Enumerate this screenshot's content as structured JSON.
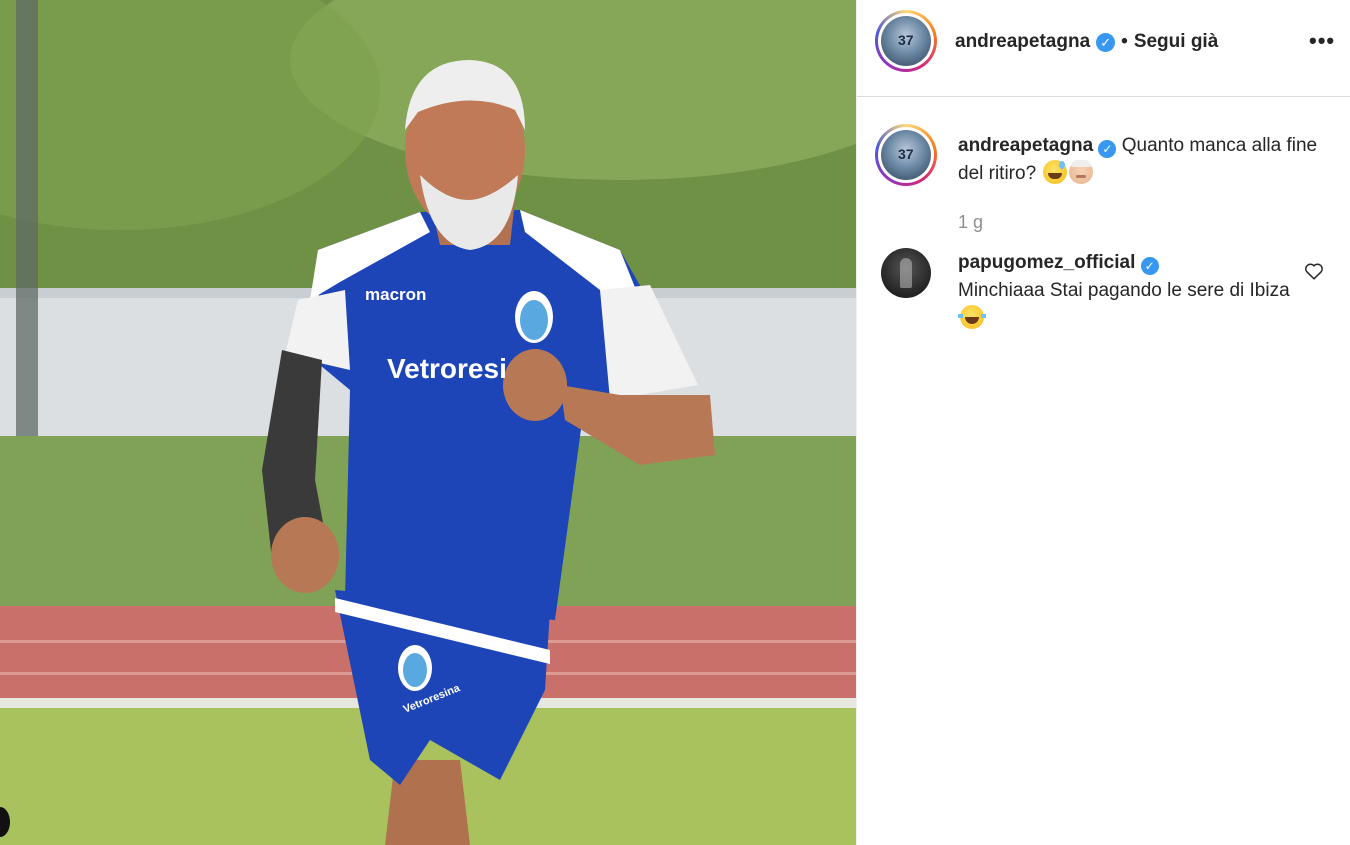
{
  "post": {
    "author": {
      "username": "andreapetagna",
      "verified_icon": "verified-badge-icon",
      "separator": "•",
      "follow_status": "Segui già"
    },
    "more_label": "•••",
    "caption": {
      "username": "andreapetagna",
      "text": "Quanto manca alla fine del ritiro?",
      "emojis": [
        "grinning-sweat-emoji",
        "older-man-emoji"
      ]
    },
    "time_ago": "1 g",
    "comments": [
      {
        "username": "papugomez_official",
        "text": "Minchiaaa Stai pagando le sere di Ibiza",
        "emoji": "tears-of-joy-emoji",
        "like_icon": "heart-outline-icon"
      }
    ]
  },
  "photo": {
    "description_icon": "football-player-photo",
    "shirt_brand": "macron",
    "shirt_sponsor": "Vetroresi",
    "shorts_sponsor": "Vetroresina"
  },
  "colors": {
    "verified": "#3897f0",
    "text_primary": "#262626",
    "text_secondary": "#8e8e8e",
    "border": "#dbdbdb",
    "kit_blue": "#1d45b8"
  }
}
